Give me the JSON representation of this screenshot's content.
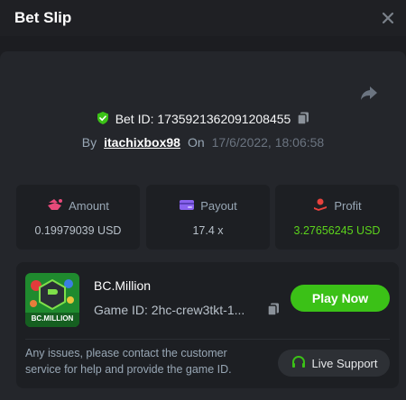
{
  "header": {
    "title": "Bet Slip"
  },
  "bet": {
    "id_label": "Bet ID: 1735921362091208455",
    "by_label": "By",
    "username": "itachixbox98",
    "on_label": "On",
    "datetime": "17/6/2022, 18:06:58"
  },
  "stats": {
    "amount": {
      "label": "Amount",
      "value": "0.19979039 USD"
    },
    "payout": {
      "label": "Payout",
      "value": "17.4 x"
    },
    "profit": {
      "label": "Profit",
      "value": "3.27656245 USD"
    }
  },
  "game": {
    "name": "BC.Million",
    "id_label": "Game ID: 2hc-crew3tkt-1...",
    "thumb_text": "BC.MILLION",
    "play_label": "Play Now",
    "note": "Any issues, please contact the customer service for help and provide the game ID.",
    "support_label": "Live Support"
  },
  "colors": {
    "accent_green": "#3bc117",
    "profit_green": "#5cd31c",
    "amount_icon": "#e84a7a",
    "payout_icon": "#8a63f0",
    "profit_icon": "#e8423d"
  }
}
